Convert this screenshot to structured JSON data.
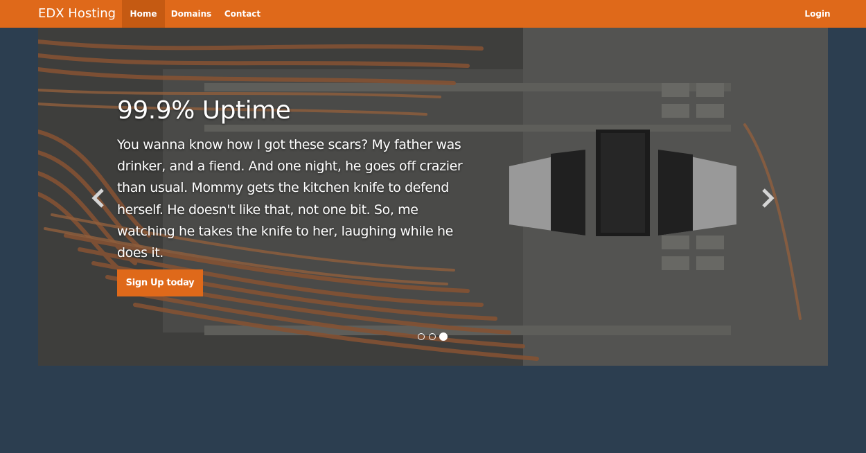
{
  "navbar": {
    "brand": "EDX Hosting",
    "items": [
      {
        "label": "Home",
        "active": true
      },
      {
        "label": "Domains",
        "active": false
      },
      {
        "label": "Contact",
        "active": false
      }
    ],
    "login": "Login",
    "color": "#df691a"
  },
  "carousel": {
    "title": "99.9% Uptime",
    "text": "You wanna know how I got these scars? My father was drinker, and a fiend. And one night, he goes off crazier than usual. Mommy gets the kitchen knife to defend herself. He doesn't like that, not one bit. So, me watching he takes the knife to her, laughing while he does it.",
    "cta": "Sign Up today",
    "slide_count": 3,
    "active_slide": 3
  },
  "page_background": "#2c3e50"
}
